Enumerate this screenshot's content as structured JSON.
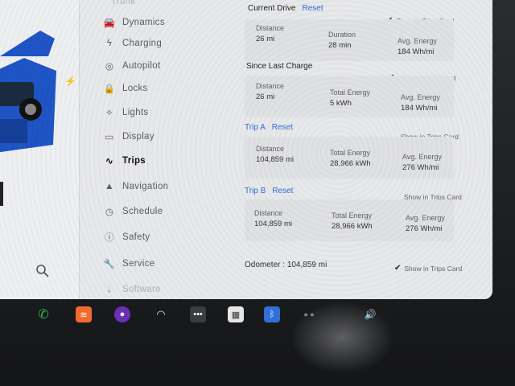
{
  "sidebar": {
    "items": [
      {
        "label": "Trunk",
        "icon": "trunk-icon",
        "faint": true
      },
      {
        "label": "Dynamics",
        "icon": "car-dynamics-icon"
      },
      {
        "label": "Charging",
        "icon": "charging-bolt-icon"
      },
      {
        "label": "Autopilot",
        "icon": "steering-wheel-icon"
      },
      {
        "label": "Locks",
        "icon": "lock-icon"
      },
      {
        "label": "Lights",
        "icon": "light-bulb-icon"
      },
      {
        "label": "Display",
        "icon": "display-icon"
      },
      {
        "label": "Trips",
        "icon": "trips-icon",
        "active": true
      },
      {
        "label": "Navigation",
        "icon": "navigation-arrow-icon"
      },
      {
        "label": "Schedule",
        "icon": "clock-icon"
      },
      {
        "label": "Safety",
        "icon": "safety-icon"
      },
      {
        "label": "Service",
        "icon": "wrench-icon"
      },
      {
        "label": "Software",
        "icon": "download-icon",
        "faint": true
      }
    ]
  },
  "trips": {
    "current": {
      "title": "Current Drive",
      "reset": "Reset",
      "show": "Show in Trips Card",
      "distance_label": "Distance",
      "distance": "26 mi",
      "duration_label": "Duration",
      "duration": "28 min",
      "energy_label": "Avg. Energy",
      "energy": "184 Wh/mi"
    },
    "since_charge": {
      "title": "Since Last Charge",
      "show": "Show in Trips Card",
      "distance_label": "Distance",
      "distance": "26 mi",
      "total_label": "Total Energy",
      "total": "5 kWh",
      "energy_label": "Avg. Energy",
      "energy": "184 Wh/mi"
    },
    "trip_a": {
      "title": "Trip A",
      "reset": "Reset",
      "show": "Show in Trips Card",
      "distance_label": "Distance",
      "distance": "104,859 mi",
      "total_label": "Total Energy",
      "total": "28,966 kWh",
      "energy_label": "Avg. Energy",
      "energy": "276 Wh/mi"
    },
    "trip_b": {
      "title": "Trip B",
      "reset": "Reset",
      "show": "Show in Trips Card",
      "distance_label": "Distance",
      "distance": "104,859 mi",
      "total_label": "Total Energy",
      "total": "28,966 kWh",
      "energy_label": "Avg. Energy",
      "energy": "276 Wh/mi"
    },
    "odometer_label": "Odometer :",
    "odometer": "104,859 mi",
    "odometer_show": "Show in Trips Card"
  },
  "colors": {
    "accent": "#2f6fd8",
    "car": "#1f55c7"
  },
  "dock": [
    {
      "name": "phone-icon",
      "color": "#2fb84a"
    },
    {
      "name": "audio-icon",
      "color": "#f26b2d"
    },
    {
      "name": "camera-icon",
      "color": "#6b2fb8"
    },
    {
      "name": "wiper-icon",
      "color": "#3a3c40"
    },
    {
      "name": "more-icon",
      "color": "#3a3c40"
    },
    {
      "name": "calendar-icon",
      "color": "#e6e6e6"
    },
    {
      "name": "bluetooth-icon",
      "color": "#2f6fd8"
    }
  ]
}
